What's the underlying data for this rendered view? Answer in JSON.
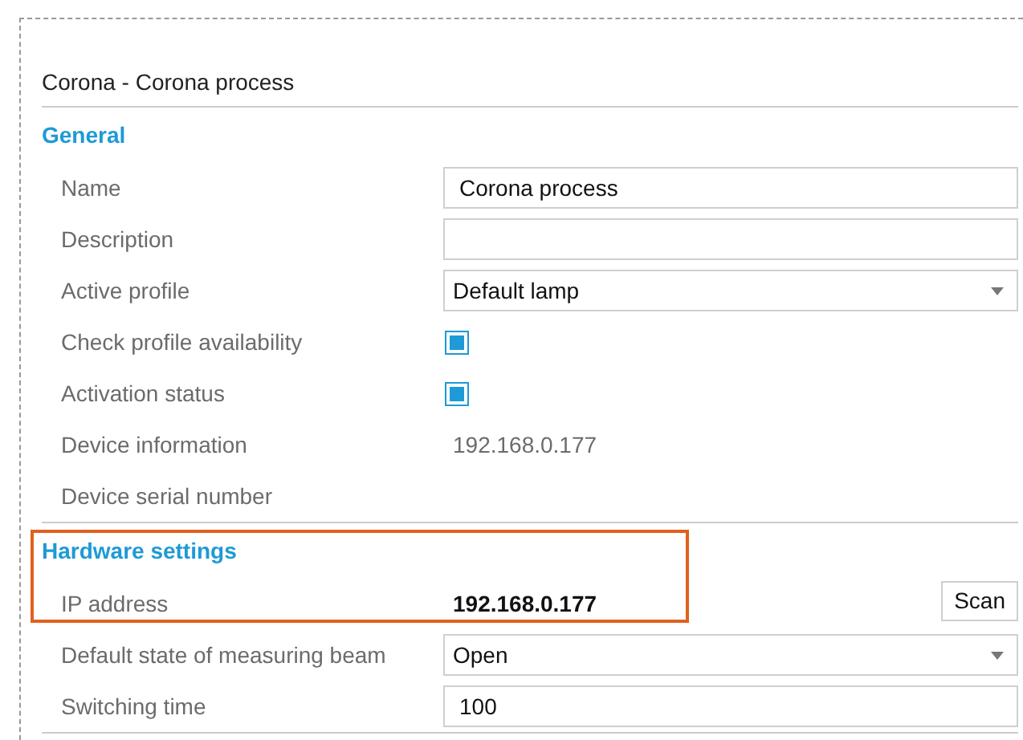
{
  "title": "Corona - Corona process",
  "sections": [
    {
      "heading": "General",
      "highlighted": false,
      "rows": [
        {
          "kind": "input",
          "label": "Name",
          "value": "Corona process"
        },
        {
          "kind": "input",
          "label": "Description"
        },
        {
          "kind": "select",
          "label": "Active profile",
          "value": "Default lamp"
        },
        {
          "kind": "checkbox",
          "label": "Check profile availability",
          "checked": true
        },
        {
          "kind": "checkbox",
          "label": "Activation status",
          "checked": true
        },
        {
          "kind": "info",
          "label": "Device information",
          "value": "192.168.0.177"
        },
        {
          "kind": "info",
          "label": "Device serial number"
        }
      ]
    },
    {
      "heading": "Hardware settings",
      "highlighted": true,
      "rows": [
        {
          "kind": "address",
          "label": "IP address",
          "value": "192.168.0.177",
          "button": "Scan"
        },
        {
          "kind": "select",
          "label": "Default state of measuring beam",
          "value": "Open"
        },
        {
          "kind": "input",
          "label": "Switching time",
          "value": "100"
        }
      ]
    }
  ]
}
